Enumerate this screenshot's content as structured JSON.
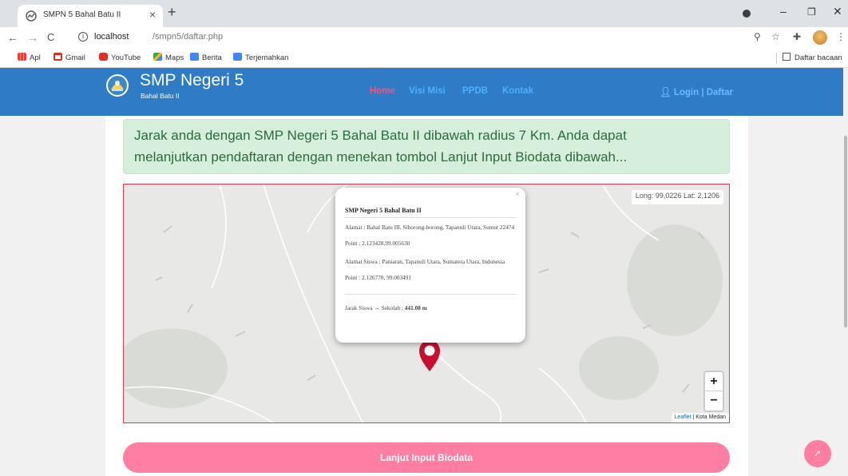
{
  "browser": {
    "tab_title": "SMPN 5 Bahal Batu II",
    "url_host": "localhost",
    "url_path": "/smpn5/daftar.php",
    "bookmarks": [
      "Apl",
      "Gmail",
      "YouTube",
      "Maps",
      "Berita",
      "Terjemahkan"
    ],
    "reading_list": "Daftar bacaan",
    "icons": [
      "globe-icon",
      "close-icon",
      "plus-icon",
      "back-arrow-icon",
      "forward-arrow-icon",
      "reload-icon",
      "info-icon",
      "zoom-icon",
      "star-icon",
      "puzzle-icon"
    ]
  },
  "site": {
    "name": "SMP Negeri 5",
    "subname": "Bahal Batu II",
    "menu": [
      "Home",
      "Visi Misi",
      "PPDB",
      "Kontak"
    ],
    "login": "Login",
    "register": "| Daftar",
    "colors": {
      "header": "#2f7bc6",
      "accent": "#fe7ea3",
      "alert_bg": "#d6efdd",
      "alert_text": "#2d6a3e"
    }
  },
  "alert": {
    "line1": "Jarak anda dengan SMP Negeri 5 Bahal Batu II dibawah radius 7 Km. Anda dapat",
    "line2": "melanjutkan pendaftaran dengan menekan tombol Lanjut Input Biodata dibawah..."
  },
  "map": {
    "coord": "Long: 99,0226 Lat: 2,1206",
    "zoom_in": "+",
    "zoom_out": "−",
    "attribution_link": "Leaflet",
    "attribution_text": "| Kota Medan",
    "popup": {
      "close": "×",
      "title": "SMP Negeri 5 Bahal Batu II",
      "school_address": "Alamat : Bahal Batu III, Siborong-borong, Tapanuli Utara, Sumut 22474",
      "school_point": "Point : 2.123428,99.005630",
      "student_address": "Alamat Siswa : Paniaran, Tapanuli Utara, Sumatera Utara, Indonesia",
      "student_point": "Point : 2.126770, 99.003491",
      "distance_label": "Jarak Siswa → Sekolah : ",
      "distance_value": "441.08 m"
    }
  },
  "button_label": "Lanjut Input Biodata",
  "fab_icon": "arrow-icon"
}
